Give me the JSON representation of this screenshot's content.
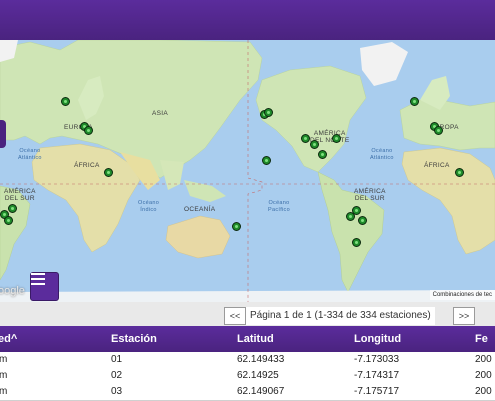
{
  "map": {
    "labels": {
      "asia": "ASIA",
      "europa_left": "EUROPA",
      "europa_right": "EUROPA",
      "africa_left": "ÁFRICA",
      "africa_right": "ÁFRICA",
      "oceania": "OCEANÍA",
      "america_norte": "AMÉRICA\nDEL NORTE",
      "america_sur_left": "AMÉRICA\nDEL SUR",
      "america_sur_right": "AMÉRICA\nDEL SUR",
      "oceano_atlantico_left": "Océano\nAtlántico",
      "oceano_atlantico_right": "Océano\nAtlántico",
      "oceano_indico": "Océano\nÍndico",
      "oceano_pacifico": "Océano\nPacífico"
    },
    "google_logo": "oogle",
    "attribution": "Combinaciones de tec",
    "marker_color": "#1f8a2a"
  },
  "pager": {
    "prev_label": "<<",
    "next_label": ">>",
    "status": "Página 1 de 1 (1-334 de 334 estaciones)"
  },
  "table": {
    "headers": [
      "ed^",
      "Estación",
      "Latitud",
      "Longitud",
      "Fe"
    ],
    "rows": [
      [
        "xm",
        "01",
        "62.149433",
        "-7.173033",
        "200"
      ],
      [
        "xm",
        "02",
        "62.14925",
        "-7.174317",
        "200"
      ],
      [
        "xm",
        "03",
        "62.149067",
        "-7.175717",
        "200"
      ]
    ]
  },
  "colors": {
    "header_purple": "#4a237f",
    "ocean": "#a9cdee",
    "land": "#cfe5b5"
  }
}
